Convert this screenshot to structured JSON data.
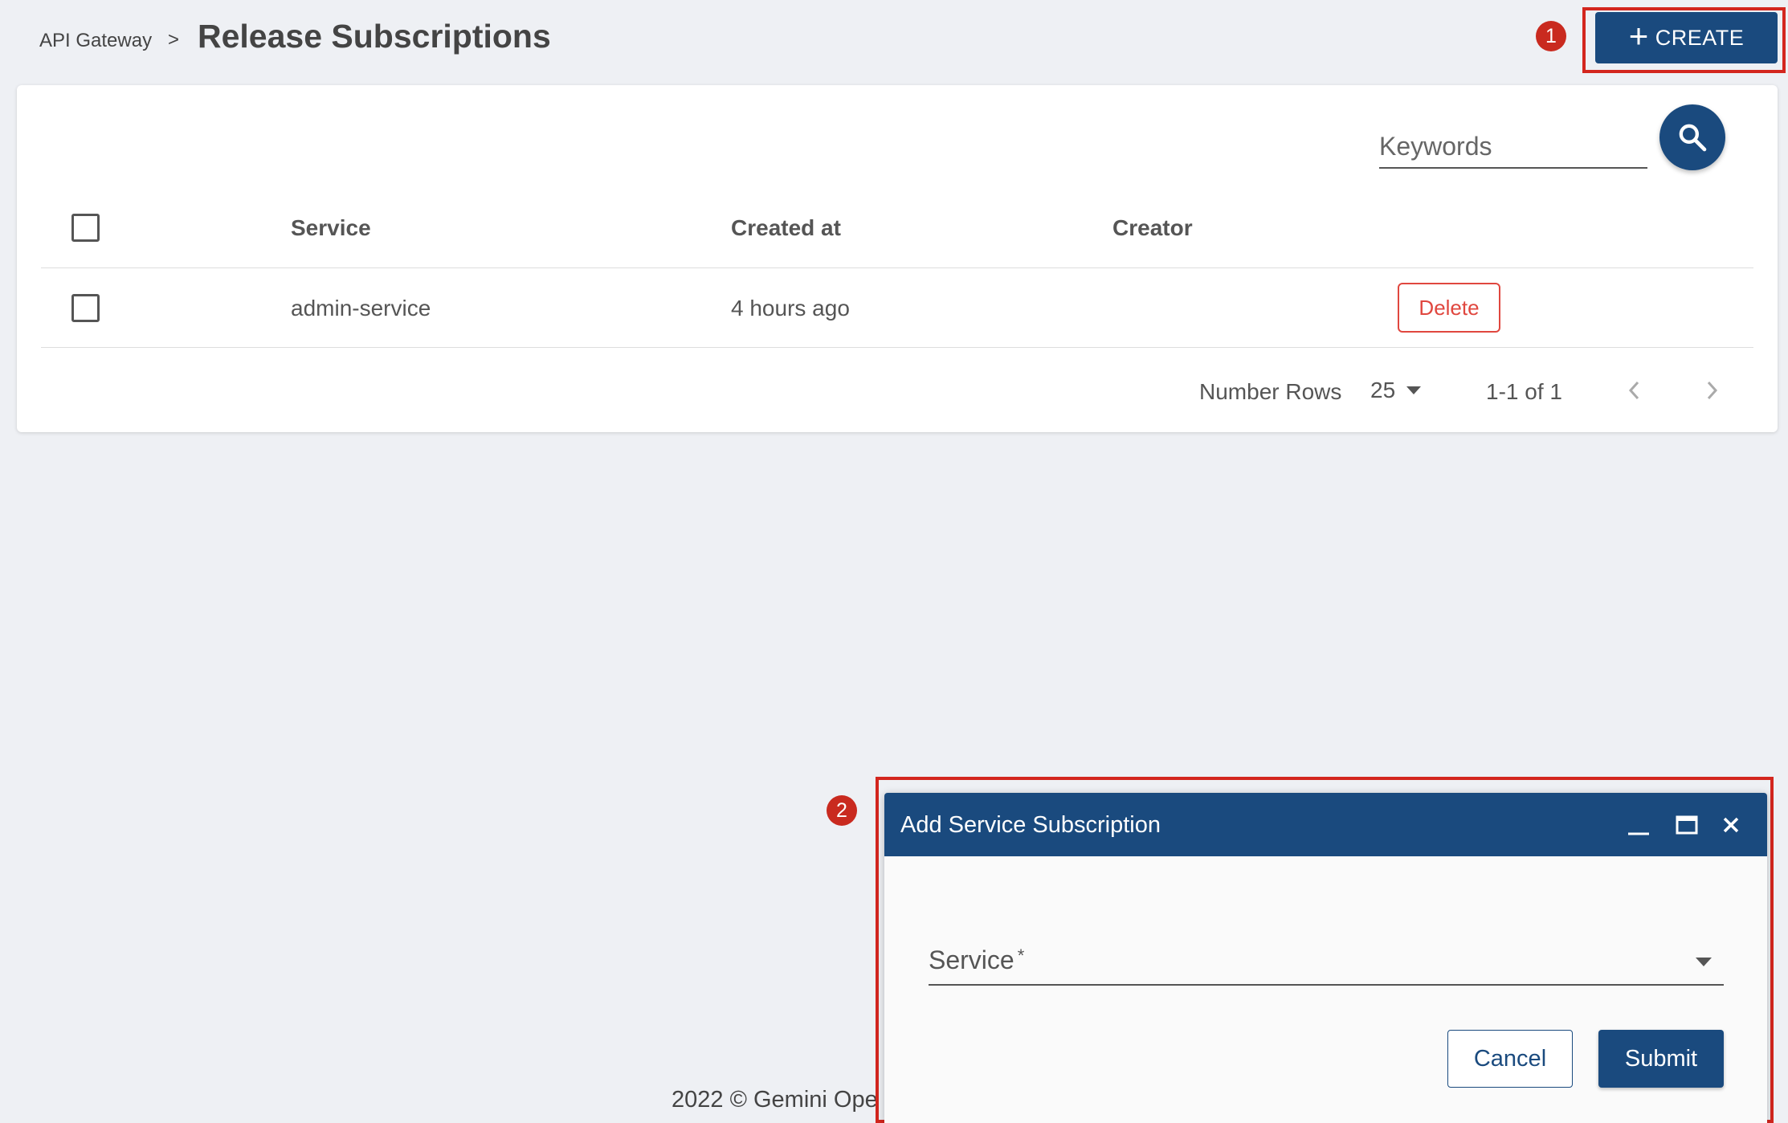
{
  "header": {
    "breadcrumb_root": "API Gateway",
    "breadcrumb_separator": ">",
    "title": "Release Subscriptions",
    "create_label": "CREATE"
  },
  "annotations": {
    "badge_1": "1",
    "badge_2": "2"
  },
  "search": {
    "placeholder": "Keywords"
  },
  "table": {
    "columns": [
      "Service",
      "Created at",
      "Creator"
    ],
    "rows": [
      {
        "service": "admin-service",
        "created_at": "4 hours ago",
        "creator": "",
        "action": "Delete"
      }
    ]
  },
  "pagination": {
    "rows_label": "Number Rows",
    "rows_per_page": "25",
    "range": "1-1 of 1"
  },
  "footer": {
    "text": "2022 © Gemini Ope"
  },
  "dialog": {
    "title": "Add Service Subscription",
    "service_label": "Service",
    "required_mark": "*",
    "cancel_label": "Cancel",
    "submit_label": "Submit"
  },
  "colors": {
    "primary": "#1a4a7e",
    "danger": "#e0473f",
    "annotation": "#d3261e",
    "background": "#eef0f4"
  },
  "icons": [
    "plus-icon",
    "search-icon",
    "chevron-left-icon",
    "chevron-right-icon",
    "caret-down-icon",
    "minimize-icon",
    "maximize-icon",
    "close-icon"
  ]
}
